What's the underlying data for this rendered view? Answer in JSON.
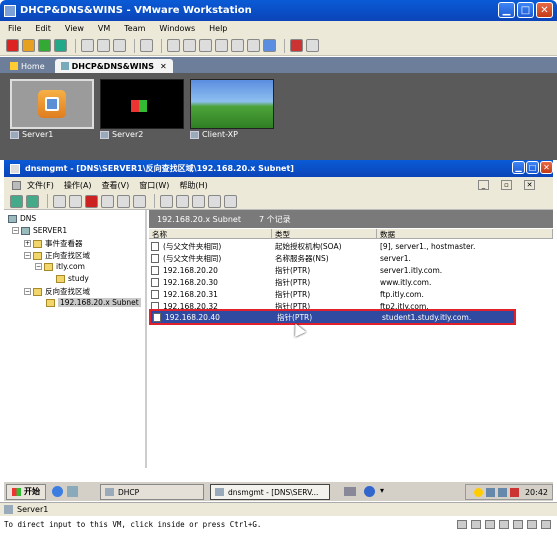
{
  "vmware": {
    "title": "DHCP&DNS&WINS - VMware Workstation",
    "menu": [
      "File",
      "Edit",
      "View",
      "VM",
      "Team",
      "Windows",
      "Help"
    ],
    "tabs": [
      "Home",
      "DHCP&DNS&WINS"
    ],
    "thumbnails": [
      "Server1",
      "Server2",
      "Client-XP"
    ],
    "status_vm": "Server1",
    "status_hint": "To direct input to this VM, click inside or press Ctrl+G."
  },
  "mmc": {
    "title": "dnsmgmt - [DNS\\SERVER1\\反向查找区域\\192.168.20.x Subnet]",
    "menu": [
      "文件(F)",
      "操作(A)",
      "查看(V)",
      "窗口(W)",
      "帮助(H)"
    ],
    "tree": {
      "root": "DNS",
      "server": "SERVER1",
      "event_viewer": "事件查看器",
      "forward_zone": "正向查找区域",
      "zone_itly": "itly.com",
      "zone_study": "study",
      "reverse_zone": "反向查找区域",
      "reverse_subnet": "192.168.20.x Subnet"
    },
    "panel_header": "192.168.20.x Subnet",
    "record_count": "7 个记录",
    "columns": [
      "名称",
      "类型",
      "数据"
    ],
    "records": [
      {
        "name": "(与父文件夹相同)",
        "type": "起始授权机构(SOA)",
        "data": "[9], server1., hostmaster."
      },
      {
        "name": "(与父文件夹相同)",
        "type": "名称服务器(NS)",
        "data": "server1."
      },
      {
        "name": "192.168.20.20",
        "type": "指针(PTR)",
        "data": "server1.itly.com."
      },
      {
        "name": "192.168.20.30",
        "type": "指针(PTR)",
        "data": "www.itly.com."
      },
      {
        "name": "192.168.20.31",
        "type": "指针(PTR)",
        "data": "ftp.itly.com."
      },
      {
        "name": "192.168.20.32",
        "type": "指针(PTR)",
        "data": "ftp2.itly.com."
      },
      {
        "name": "192.168.20.40",
        "type": "指针(PTR)",
        "data": "student1.study.itly.com."
      }
    ]
  },
  "taskbar": {
    "start": "开始",
    "task_dhcp": "DHCP",
    "task_dns": "dnsmgmt - [DNS\\SERV...",
    "clock": "20:42"
  }
}
